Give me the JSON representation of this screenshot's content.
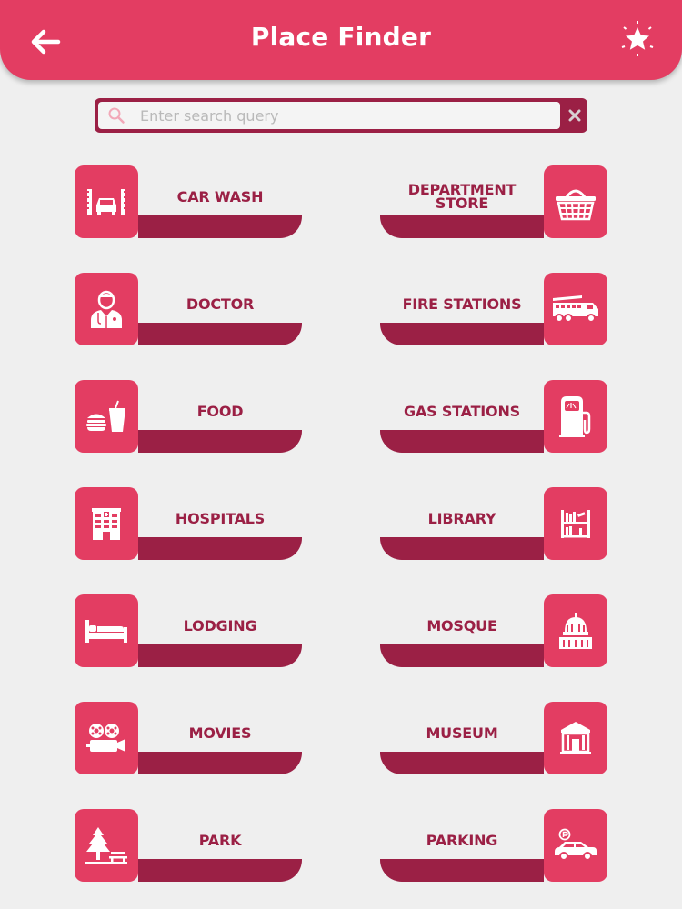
{
  "app": {
    "title": "Place Finder"
  },
  "header": {
    "back_icon": "arrow-left-icon",
    "favorite_icon": "star-icon"
  },
  "search": {
    "placeholder": "Enter search query",
    "value": "",
    "clear_icon": "close-icon",
    "search_icon": "search-icon"
  },
  "colors": {
    "primary": "#e33d62",
    "dark": "#9b2045",
    "background": "#efefef"
  },
  "categories": [
    {
      "label": "CAR WASH",
      "icon": "car-wash-icon"
    },
    {
      "label": "DEPARTMENT STORE",
      "icon": "shopping-basket-icon"
    },
    {
      "label": "DOCTOR",
      "icon": "doctor-icon"
    },
    {
      "label": "FIRE STATIONS",
      "icon": "fire-truck-icon"
    },
    {
      "label": "FOOD",
      "icon": "burger-drink-icon"
    },
    {
      "label": "GAS STATIONS",
      "icon": "fuel-pump-icon"
    },
    {
      "label": "HOSPITALS",
      "icon": "hospital-building-icon"
    },
    {
      "label": "LIBRARY",
      "icon": "bookshelf-icon"
    },
    {
      "label": "LODGING",
      "icon": "bed-icon"
    },
    {
      "label": "MOSQUE",
      "icon": "dome-icon"
    },
    {
      "label": "MOVIES",
      "icon": "film-projector-icon"
    },
    {
      "label": "MUSEUM",
      "icon": "museum-icon"
    },
    {
      "label": "PARK",
      "icon": "tree-bench-icon"
    },
    {
      "label": "PARKING",
      "icon": "car-parking-icon"
    }
  ]
}
